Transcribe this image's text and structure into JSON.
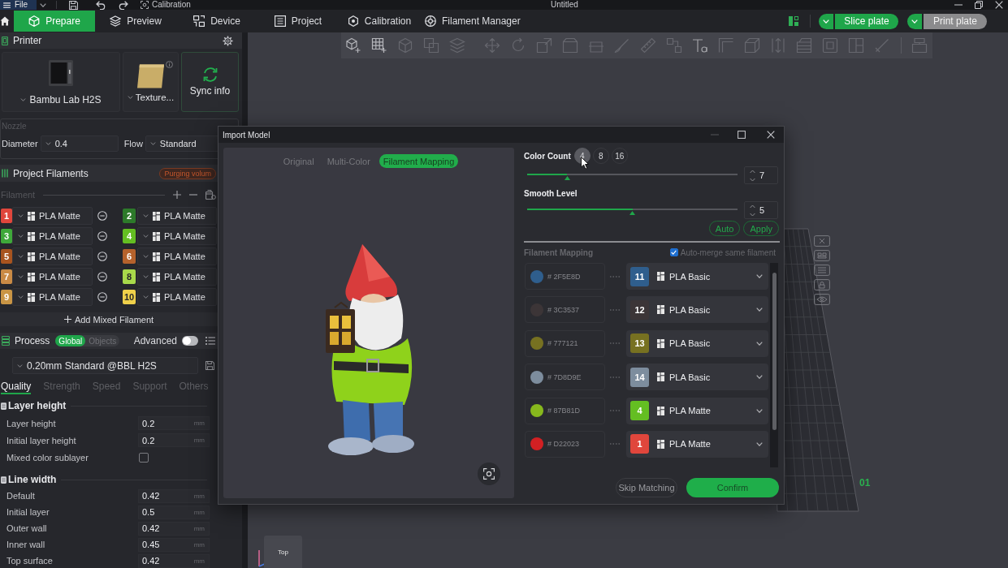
{
  "title_bar": {
    "menu": "File",
    "tool": "Calibration",
    "title": "Untitled"
  },
  "nav_tabs": [
    {
      "label": "Prepare",
      "selected": true
    },
    {
      "label": "Preview",
      "selected": false
    },
    {
      "label": "Device",
      "selected": false
    },
    {
      "label": "Project",
      "selected": false
    },
    {
      "label": "Calibration",
      "selected": false
    },
    {
      "label": "Filament Manager",
      "selected": false
    }
  ],
  "plate_actions": [
    {
      "label": "Slice plate",
      "disabled": false
    },
    {
      "label": "Print plate",
      "disabled": true
    }
  ],
  "printer": {
    "title": "Printer",
    "model": "Bambu Lab H2S",
    "plate_type": "Texture...",
    "sync": "Sync info"
  },
  "nozzle": {
    "title": "Nozzle",
    "diameter_label": "Diameter",
    "diameter": "0.4",
    "flow_label": "Flow",
    "flow": "Standard"
  },
  "project_filaments": {
    "title": "Project Filaments",
    "badge": "Purging volum",
    "label": "Filament",
    "items": [
      {
        "number": "1",
        "color": "#e0463c",
        "name": "PLA Matte"
      },
      {
        "number": "2",
        "color": "#2d7a2a",
        "name": "PLA Matte"
      },
      {
        "number": "3",
        "color": "#3fa83a",
        "name": "PLA Matte"
      },
      {
        "number": "4",
        "color": "#64be22",
        "name": "PLA Matte"
      },
      {
        "number": "5",
        "color": "#a8541f",
        "name": "PLA Matte"
      },
      {
        "number": "6",
        "color": "#b5622c",
        "name": "PLA Matte"
      },
      {
        "number": "7",
        "color": "#c98a45",
        "name": "PLA Matte"
      },
      {
        "number": "8",
        "color": "#a8d94a",
        "name": "PLA Matte"
      },
      {
        "number": "9",
        "color": "#c99545",
        "name": "PLA Matte"
      },
      {
        "number": "10",
        "color": "#efd04a",
        "name": "PLA Matte"
      }
    ],
    "add_button": "Add Mixed Filament"
  },
  "process": {
    "title": "Process",
    "scopes": [
      {
        "label": "Global",
        "selected": true
      },
      {
        "label": "Objects",
        "selected": false
      }
    ],
    "advanced_label": "Advanced",
    "advanced": false,
    "preset": "0.20mm Standard @BBL H2S",
    "tabs": [
      {
        "label": "Quality",
        "selected": true
      },
      {
        "label": "Strength",
        "selected": false
      },
      {
        "label": "Speed",
        "selected": false
      },
      {
        "label": "Support",
        "selected": false
      },
      {
        "label": "Others",
        "selected": false
      }
    ],
    "groups": [
      {
        "title": "Layer height",
        "settings": [
          {
            "kind": "number",
            "label": "Layer height",
            "value": "0.2",
            "unit": "mm"
          },
          {
            "kind": "number",
            "label": "Initial layer height",
            "value": "0.2",
            "unit": "mm"
          },
          {
            "kind": "checkbox",
            "label": "Mixed color sublayer",
            "checked": false
          }
        ]
      },
      {
        "title": "Line width",
        "settings": [
          {
            "kind": "number",
            "label": "Default",
            "value": "0.42",
            "unit": "mm"
          },
          {
            "kind": "number",
            "label": "Initial layer",
            "value": "0.5",
            "unit": "mm"
          },
          {
            "kind": "number",
            "label": "Outer wall",
            "value": "0.42",
            "unit": "mm"
          },
          {
            "kind": "number",
            "label": "Inner wall",
            "value": "0.45",
            "unit": "mm"
          },
          {
            "kind": "number",
            "label": "Top surface",
            "value": "0.42",
            "unit": "mm"
          }
        ]
      }
    ]
  },
  "viewport": {
    "plate_number": "01",
    "view_label": "Top"
  },
  "dialog": {
    "title": "Import Model",
    "views": [
      {
        "label": "Original",
        "selected": false
      },
      {
        "label": "Multi-Color",
        "selected": false
      },
      {
        "label": "Filament Mapping",
        "selected": true
      }
    ],
    "color_count": {
      "label": "Color Count",
      "options": [
        {
          "label": "4",
          "hovered": true
        },
        {
          "label": "8",
          "hovered": false
        },
        {
          "label": "16",
          "hovered": false
        }
      ],
      "level": 0.19,
      "value": "7"
    },
    "smooth": {
      "label": "Smooth Level",
      "level": 0.5,
      "value": "5"
    },
    "actions": [
      "Auto",
      "Apply"
    ],
    "mapping": {
      "title": "Filament Mapping",
      "auto_merge": {
        "label": "Auto-merge same filament",
        "checked": true
      },
      "rows": [
        {
          "color": "#2f5e8d",
          "hex": "# 2F5E8D",
          "filament": {
            "number": "11",
            "color": "#2f5e8d",
            "name": "PLA Basic"
          }
        },
        {
          "color": "#3c3537",
          "hex": "# 3C3537",
          "filament": {
            "number": "12",
            "color": "#3c3537",
            "name": "PLA Basic"
          }
        },
        {
          "color": "#777121",
          "hex": "# 777121",
          "filament": {
            "number": "13",
            "color": "#777121",
            "name": "PLA Basic"
          }
        },
        {
          "color": "#7d8d9e",
          "hex": "# 7D8D9E",
          "filament": {
            "number": "14",
            "color": "#7d8d9e",
            "name": "PLA Basic"
          }
        },
        {
          "color": "#87b81d",
          "hex": "# 87B81D",
          "filament": {
            "number": "4",
            "color": "#64be22",
            "name": "PLA Matte"
          }
        },
        {
          "color": "#d22023",
          "hex": "# D22023",
          "filament": {
            "number": "1",
            "color": "#e0463c",
            "name": "PLA Matte"
          }
        }
      ]
    },
    "footer": {
      "skip": "Skip Matching",
      "confirm": "Confirm"
    }
  }
}
